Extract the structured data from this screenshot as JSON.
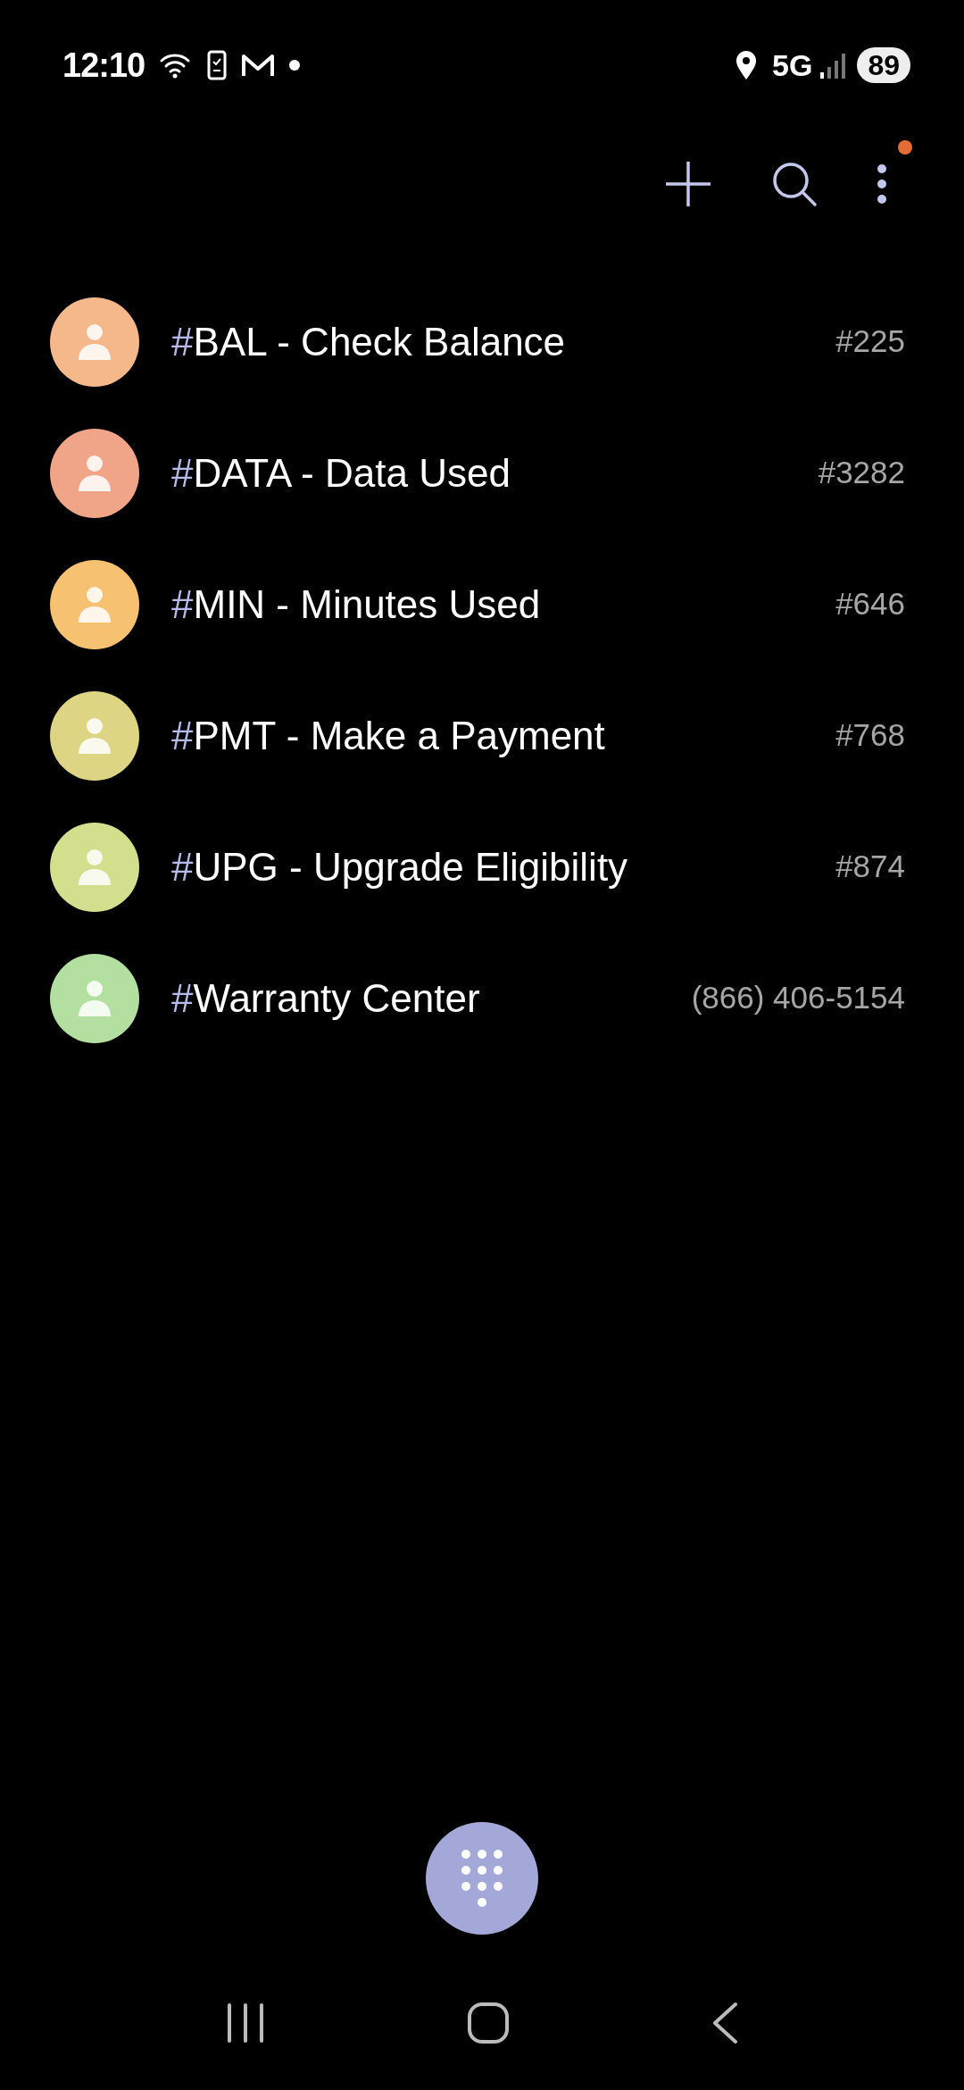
{
  "status_bar": {
    "time": "12:10",
    "network": "5G",
    "battery": "89"
  },
  "toolbar": {
    "more_badge": true
  },
  "contacts": [
    {
      "name": "**#**BAL - Check Balance",
      "number": "#225",
      "color": "#f5b88a"
    },
    {
      "name": "**#**DATA - Data Used",
      "number": "#3282",
      "color": "#f0a589"
    },
    {
      "name": "**#**MIN - Minutes Used",
      "number": "#646",
      "color": "#f6c272"
    },
    {
      "name": "**#**PMT - Make a Payment",
      "number": "#768",
      "color": "#ddd584"
    },
    {
      "name": "**#**UPG - Upgrade Eligibility",
      "number": "#874",
      "color": "#d3df8d"
    },
    {
      "name": "**#**Warranty Center",
      "number": "(866) 406-5154",
      "color": "#b3e0a1"
    }
  ]
}
